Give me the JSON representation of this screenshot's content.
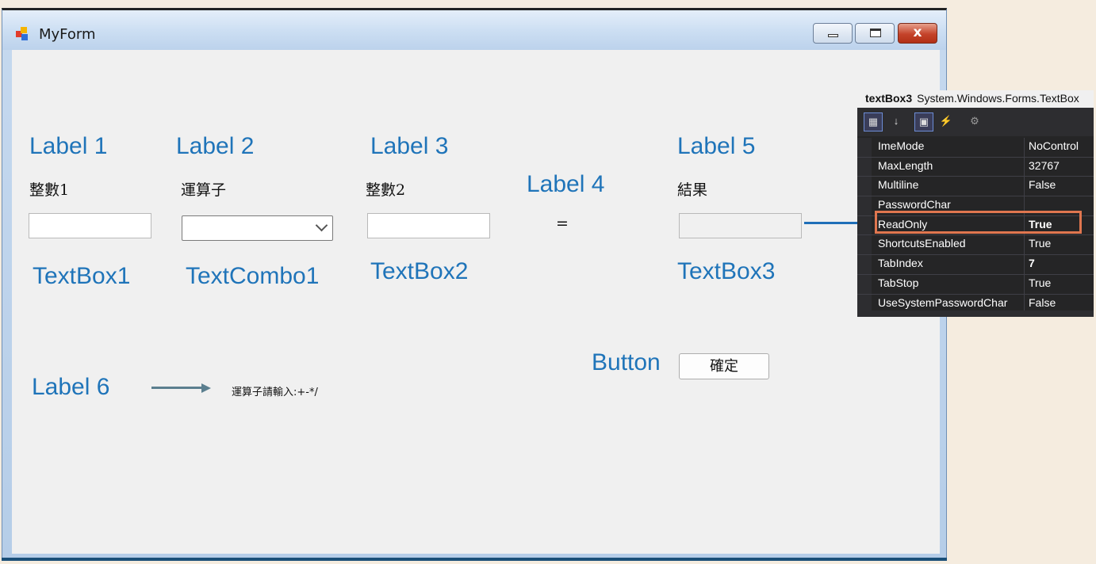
{
  "window": {
    "title": "MyForm",
    "close_glyph": "x"
  },
  "annotations": {
    "label1": "Label 1",
    "label2": "Label 2",
    "label3": "Label 3",
    "label4": "Label 4",
    "label5": "Label 5",
    "label6": "Label 6",
    "textbox1": "TextBox1",
    "textcombo1": "TextCombo1",
    "textbox2": "TextBox2",
    "textbox3": "TextBox3",
    "button": "Button"
  },
  "form": {
    "label1_text": "整數1",
    "label2_text": "運算子",
    "label3_text": "整數2",
    "label4_text": "=",
    "label5_text": "結果",
    "label6_text": "運算子請輸入:+-*/",
    "textbox1_value": "",
    "combo1_value": "",
    "textbox2_value": "",
    "textbox3_value": "",
    "button_label": "確定"
  },
  "property_grid": {
    "object_name": "textBox3",
    "object_type": "System.Windows.Forms.TextBox",
    "rows": [
      {
        "name": "ImeMode",
        "value": "NoControl",
        "bold": false
      },
      {
        "name": "MaxLength",
        "value": "32767",
        "bold": false
      },
      {
        "name": "Multiline",
        "value": "False",
        "bold": false
      },
      {
        "name": "PasswordChar",
        "value": "",
        "bold": false
      },
      {
        "name": "ReadOnly",
        "value": "True",
        "bold": true
      },
      {
        "name": "ShortcutsEnabled",
        "value": "True",
        "bold": false
      },
      {
        "name": "TabIndex",
        "value": "7",
        "bold": true
      },
      {
        "name": "TabStop",
        "value": "True",
        "bold": false
      },
      {
        "name": "UseSystemPasswordChar",
        "value": "False",
        "bold": false
      }
    ]
  },
  "colors": {
    "annotation_blue": "#1f74b9",
    "highlight": "#e0764f",
    "arrow_gray": "#5b7f8f",
    "arrow_blue": "#1f6fb8"
  }
}
